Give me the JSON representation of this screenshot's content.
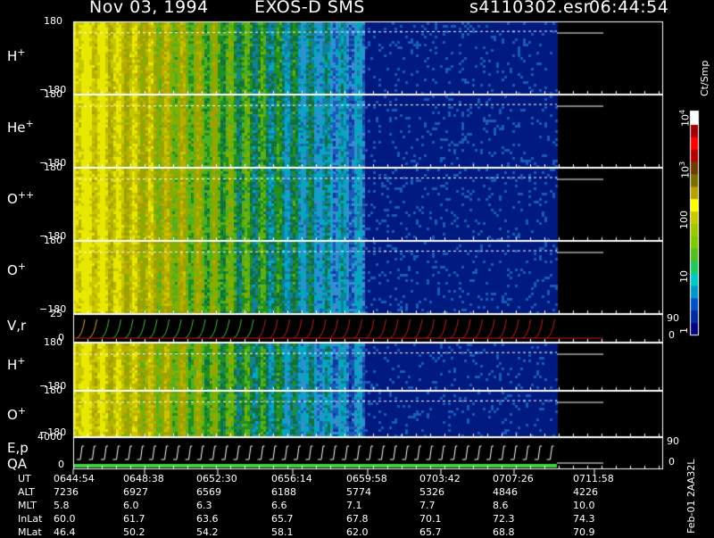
{
  "header": {
    "date": "Nov 03, 1994",
    "instrument": "EXOS-D SMS",
    "file": "s4110302.esr",
    "time": "06:44:54"
  },
  "panels": [
    {
      "label": "H",
      "sup": "+",
      "ytop": "180",
      "ybot": "−180"
    },
    {
      "label": "He",
      "sup": "+",
      "ytop": "180",
      "ybot": "−180"
    },
    {
      "label": "O",
      "sup": "++",
      "ytop": "180",
      "ybot": "−180"
    },
    {
      "label": "O",
      "sup": "+",
      "ytop": "180",
      "ybot": "−180"
    },
    {
      "label": "V,r",
      "sup": "",
      "ytop": "25",
      "ybot": "0",
      "rtop": "90",
      "rbot": "0"
    },
    {
      "label": "H",
      "sup": "+",
      "ytop": "180",
      "ybot": "−180"
    },
    {
      "label": "O",
      "sup": "+",
      "ytop": "180",
      "ybot": "−180"
    },
    {
      "label": "E,p",
      "label2": "QA",
      "sup": "",
      "ytop": "4000",
      "ybot": "0",
      "rtop": "90",
      "rbot": "0"
    }
  ],
  "colorbar": {
    "unit": "Ct/Smp",
    "ticks": [
      {
        "base": "10",
        "exp": "4"
      },
      {
        "base": "10",
        "exp": "3"
      },
      {
        "base": "100",
        "exp": ""
      },
      {
        "base": "10",
        "exp": ""
      },
      {
        "base": "1",
        "exp": ""
      }
    ],
    "colors": [
      "#000080",
      "#002a9e",
      "#0050c8",
      "#0096c8",
      "#00c8c8",
      "#20c860",
      "#50c020",
      "#80c800",
      "#a0c800",
      "#c8c800",
      "#ffff00",
      "#b8a000",
      "#7a6e00",
      "#6e3c00",
      "#b00000",
      "#ff0000",
      "#a00000",
      "#ffffff"
    ]
  },
  "side_label": "Feb-01 2AA32L",
  "footer": {
    "rows": [
      {
        "label": "UT",
        "values": [
          "0644:54",
          "0648:38",
          "0652:30",
          "0656:14",
          "0659:58",
          "0703:42",
          "0707:26",
          "0711:58"
        ]
      },
      {
        "label": "ALT",
        "values": [
          "7236",
          "6927",
          "6569",
          "6188",
          "5774",
          "5326",
          "4846",
          "4226"
        ]
      },
      {
        "label": "MLT",
        "values": [
          "5.8",
          "6.0",
          "6.3",
          "6.6",
          "7.1",
          "7.7",
          "8.6",
          "10.0"
        ]
      },
      {
        "label": "InLat",
        "values": [
          "60.0",
          "61.7",
          "63.6",
          "65.7",
          "67.8",
          "70.1",
          "72.3",
          "74.3"
        ]
      },
      {
        "label": "MLat",
        "values": [
          "46.4",
          "50.2",
          "54.2",
          "58.1",
          "62.0",
          "65.7",
          "68.8",
          "70.9"
        ]
      }
    ]
  },
  "chart_data": {
    "type": "heatmap",
    "x_axis": "UT",
    "x_ticks": [
      "0644:54",
      "0648:38",
      "0652:30",
      "0656:14",
      "0659:58",
      "0703:42",
      "0707:26",
      "0711:58"
    ],
    "panels": [
      "H+",
      "He+",
      "O++",
      "O+",
      "V,r",
      "H+",
      "O+",
      "E,p QA"
    ],
    "y_range": [
      -180,
      180
    ],
    "colorbar_unit": "Ct/Smp",
    "colorbar_ticks": [
      "1",
      "10",
      "100",
      "10^3",
      "10^4"
    ],
    "colorbar_scale": "log"
  }
}
